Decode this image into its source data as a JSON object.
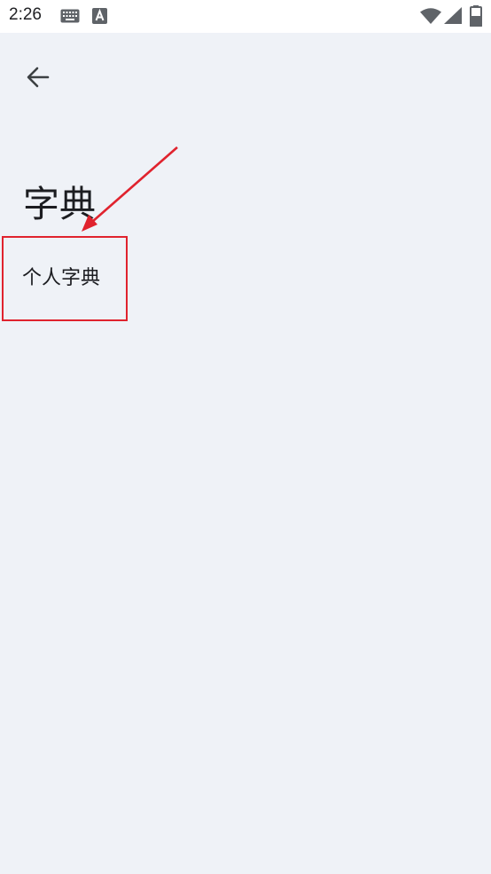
{
  "status_bar": {
    "time": "2:26",
    "icons": [
      "keyboard-icon",
      "a-icon",
      "wifi-icon",
      "signal-icon",
      "battery-icon"
    ]
  },
  "header": {
    "back_icon": "arrow-left-icon"
  },
  "page": {
    "title": "字典",
    "items": [
      {
        "label": "个人字典"
      }
    ]
  },
  "colors": {
    "background": "#eff2f7",
    "status_bar": "#ffffff",
    "text": "#1c1d21",
    "annotation": "#e0232e"
  }
}
